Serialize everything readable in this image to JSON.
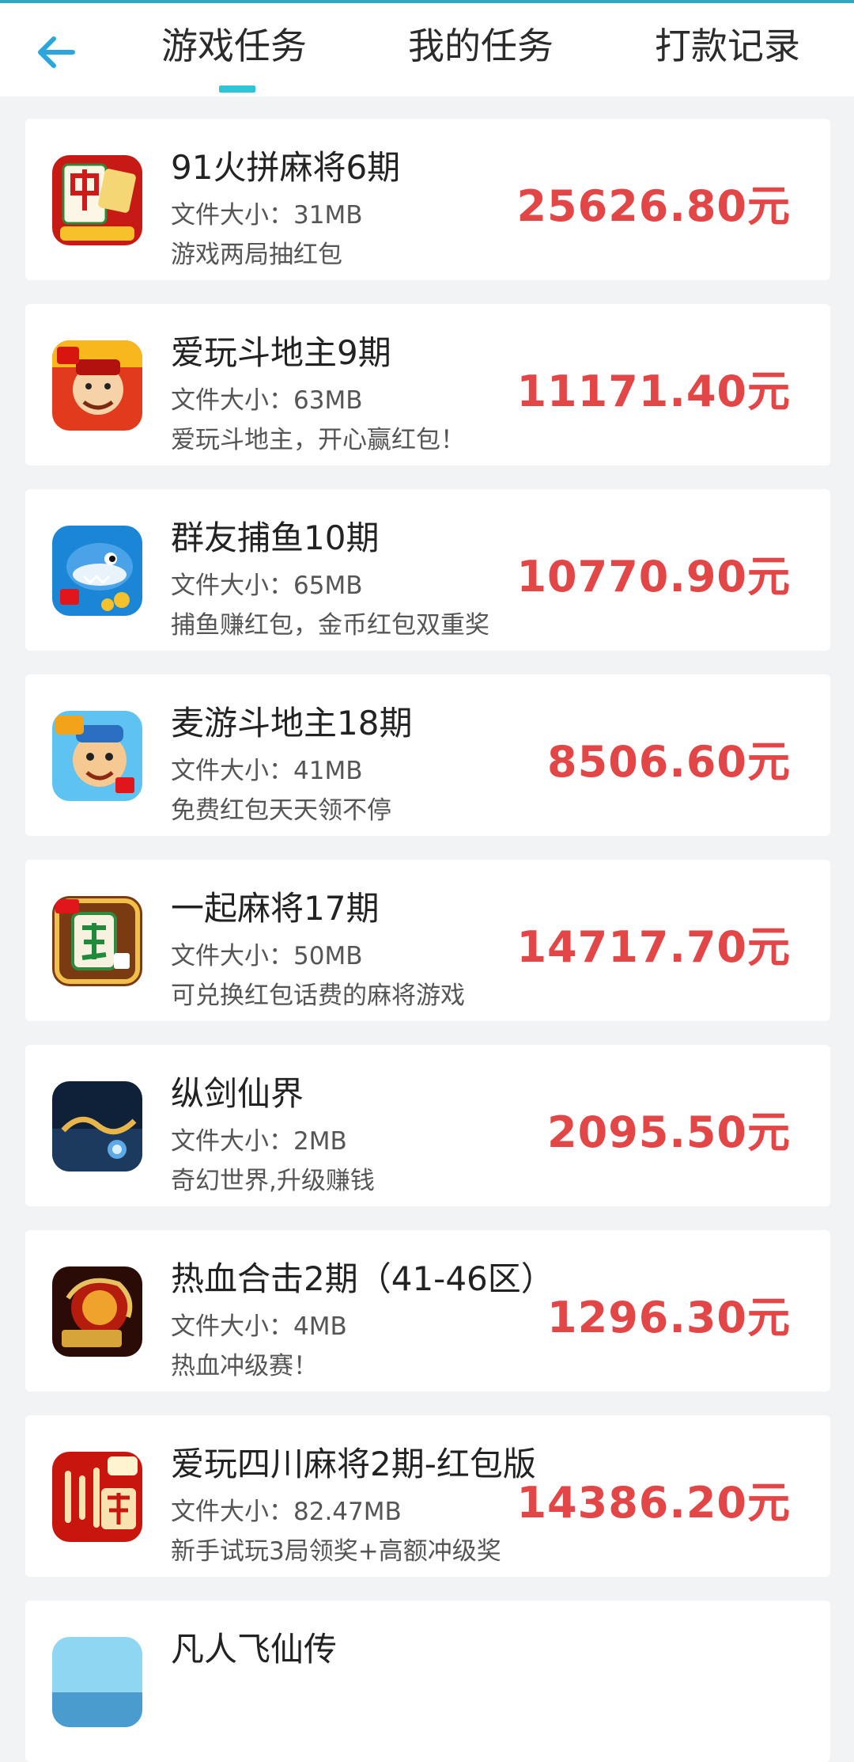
{
  "header": {
    "tabs": [
      "游戏任务",
      "我的任务",
      "打款记录"
    ],
    "active_tab": 0,
    "accent_color": "#2ec5d6",
    "back_icon": "back-arrow-icon"
  },
  "price_color": "#e24646",
  "tasks": [
    {
      "title": "91火拼麻将6期",
      "size": "文件大小：31MB",
      "desc": "游戏两局抽红包",
      "price": "25626.80元",
      "icon": "mahjong-zhong-icon"
    },
    {
      "title": "爱玩斗地主9期",
      "size": "文件大小：63MB",
      "desc": "爱玩斗地主，开心赢红包！",
      "price": "11171.40元",
      "icon": "doudizhu-landlord-icon"
    },
    {
      "title": "群友捕鱼10期",
      "size": "文件大小：65MB",
      "desc": "捕鱼赚红包，金币红包双重奖",
      "price": "10770.90元",
      "icon": "fishing-shark-icon"
    },
    {
      "title": "麦游斗地主18期",
      "size": "文件大小：41MB",
      "desc": "免费红包天天领不停",
      "price": "8506.60元",
      "icon": "doudizhu-farmer-icon"
    },
    {
      "title": "一起麻将17期",
      "size": "文件大小：50MB",
      "desc": "可兑换红包话费的麻将游戏",
      "price": "14717.70元",
      "icon": "mahjong-fa-icon"
    },
    {
      "title": "纵剑仙界",
      "size": "文件大小：2MB",
      "desc": "奇幻世界,升级赚钱",
      "price": "2095.50元",
      "icon": "xianjie-fantasy-icon"
    },
    {
      "title": "热血合击2期（41-46区）",
      "size": "文件大小：4MB",
      "desc": "热血冲级赛！",
      "price": "1296.30元",
      "icon": "rexue-dragon-icon"
    },
    {
      "title": "爱玩四川麻将2期-红包版",
      "size": "文件大小：82.47MB",
      "desc": "新手试玩3局领奖+高额冲级奖",
      "price": "14386.20元",
      "icon": "sichuan-mahjong-icon"
    },
    {
      "title": "凡人飞仙传",
      "size": "",
      "desc": "",
      "price": "",
      "icon": "fanren-feixian-icon"
    }
  ]
}
